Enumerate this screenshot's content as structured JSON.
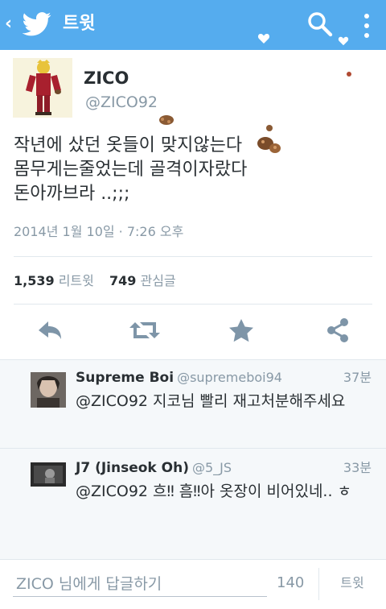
{
  "app_bar": {
    "back_icon": "chevron-left-icon",
    "logo_icon": "twitter-bird-icon",
    "title": "트윗",
    "search_icon": "search-icon",
    "menu_icon": "overflow-menu-icon",
    "color": "#55acee"
  },
  "tweet": {
    "author_name": "ZICO",
    "author_handle": "@ZICO92",
    "text_lines": [
      "작년에 샀던 옷들이 맞지않는다",
      "몸무게는줄었는데 골격이자랐다",
      "돈아까브라 ..;;;"
    ],
    "timestamp": "2014년 1월 10일 · 7:26 오후",
    "retweet_count": "1,539",
    "retweet_label": "리트윗",
    "favorite_count": "749",
    "favorite_label": "관심글",
    "actions": [
      "reply-icon",
      "retweet-icon",
      "favorite-star-icon",
      "share-icon"
    ]
  },
  "replies": [
    {
      "name": "Supreme Boi",
      "handle": "@supremeboi94",
      "time": "37분",
      "text": "@ZICO92 지코님 빨리 재고처분해주세요"
    },
    {
      "name": "J7 (Jinseok Oh)",
      "handle": "@5_JS",
      "time": "33분",
      "text": "@ZICO92 흐‼ 흠‼아 옷장이 비어있네.. ㅎ"
    }
  ],
  "composer": {
    "placeholder": "ZICO 님에게 답글하기",
    "char_count": "140",
    "tweet_button": "트윗"
  },
  "colors": {
    "accent": "#55acee",
    "text_primary": "#292f33",
    "text_secondary": "#8899a6",
    "action_icon": "#7e95a8"
  }
}
